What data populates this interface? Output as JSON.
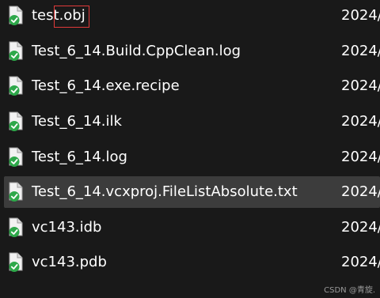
{
  "files": [
    {
      "name": "test.obj",
      "date": "2024/",
      "icon": "file-synced-icon"
    },
    {
      "name": "Test_6_14.Build.CppClean.log",
      "date": "2024/",
      "icon": "file-synced-icon"
    },
    {
      "name": "Test_6_14.exe.recipe",
      "date": "2024/",
      "icon": "file-synced-icon"
    },
    {
      "name": "Test_6_14.ilk",
      "date": "2024/",
      "icon": "file-synced-icon"
    },
    {
      "name": "Test_6_14.log",
      "date": "2024/",
      "icon": "file-synced-icon"
    },
    {
      "name": "Test_6_14.vcxproj.FileListAbsolute.txt",
      "date": "2024/",
      "icon": "file-synced-icon"
    },
    {
      "name": "vc143.idb",
      "date": "2024/",
      "icon": "file-synced-icon"
    },
    {
      "name": "vc143.pdb",
      "date": "2024/",
      "icon": "file-synced-icon"
    }
  ],
  "selected_index": 5,
  "annotation": {
    "color": "#e03a3a"
  },
  "colors": {
    "background": "#191919",
    "selected": "#3c3c3c",
    "sync_check": "#2ea84a"
  },
  "watermark": "CSDN @青旋."
}
